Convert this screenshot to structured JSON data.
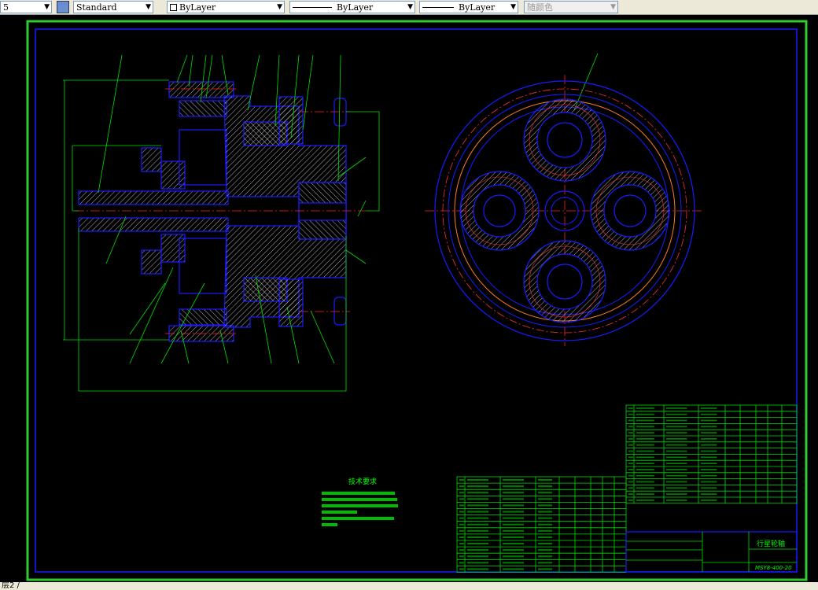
{
  "toolbar": {
    "layer_value": "5",
    "text_style": "Standard",
    "color": "ByLayer",
    "linetype": "ByLayer",
    "lineweight": "ByLayer",
    "plot_style": "随颜色"
  },
  "drawing": {
    "tech_requirements_title": "技术要求",
    "title_block": {
      "part_name": "行星轮轴",
      "drawing_number": "MSY8-400-20"
    }
  },
  "colors": {
    "background": "#000000",
    "outline": "#0000ff",
    "annotation": "#00ff00",
    "centerline": "#ff0000",
    "hatch": "#ffffff"
  },
  "command_line": "层2 /"
}
